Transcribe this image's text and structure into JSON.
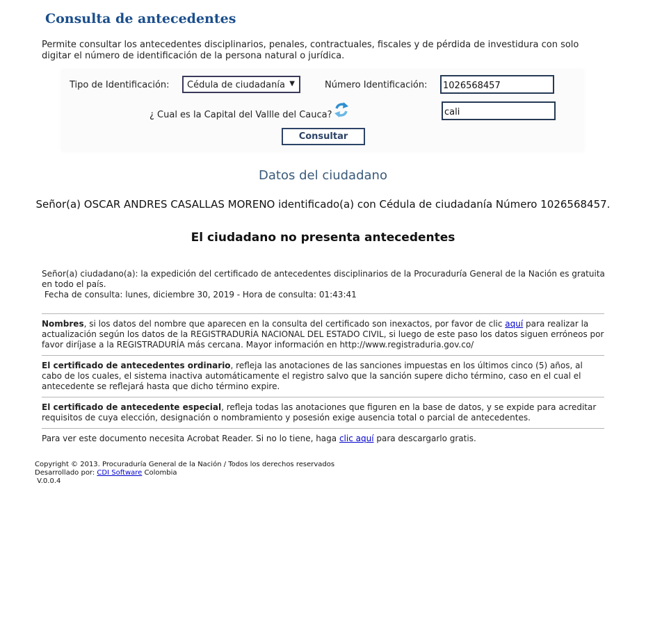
{
  "header": {
    "title": "Consulta de antecedentes"
  },
  "intro": "Permite consultar los antecedentes disciplinarios, penales, contractuales, fiscales y de pérdida de investidura con solo digitar el número de identificación de la persona natural o jurídica.",
  "form": {
    "id_type_label": "Tipo de Identificación:",
    "id_type_value": "Cédula de ciudadanía",
    "id_number_label": "Número Identificación:",
    "id_number_value": "1026568457",
    "question_label": "¿ Cual es la Capital del Vallle del Cauca?",
    "answer_value": "cali",
    "submit_label": "Consultar"
  },
  "result": {
    "section_title": "Datos del ciudadano",
    "citizen_line": "Señor(a)  OSCAR ANDRES CASALLAS MORENO identificado(a) con Cédula de ciudadanía Número 1026568457.",
    "status": "El ciudadano no presenta antecedentes"
  },
  "notice": {
    "free_text": "Señor(a) ciudadano(a): la expedición del certificado de antecedentes disciplinarios de la Procuraduría General de la Nación es gratuita en todo el país.",
    "date_line": " Fecha de consulta: lunes, diciembre 30, 2019 - Hora de consulta: 01:43:41"
  },
  "names_note": {
    "bold": "Nombres",
    "text1": ", si los datos del nombre que aparecen en la consulta del certificado son inexactos, por favor de clic ",
    "link": "aquí",
    "text2": " para realizar la actualización según los datos de la REGISTRADURÍA NACIONAL DEL ESTADO CIVIL, si luego de este paso los datos siguen erróneos por favor diríjase a la REGISTRADURÍA más cercana. Mayor información en http://www.registraduria.gov.co/"
  },
  "ordinary_note": {
    "bold": "El certificado de antecedentes ordinario",
    "text": ", refleja las anotaciones de las sanciones impuestas en los últimos cinco (5) años, al cabo de los cuales, el sistema inactiva automáticamente el registro salvo que la sanción supere dicho término, caso en el cual el antecedente se reflejará hasta que dicho término expire."
  },
  "special_note": {
    "bold": "El certificado de antecedente especial",
    "text": ", refleja todas las anotaciones que figuren en la base de datos, y se expide para acreditar requisitos de cuya elección, designación o nombramiento y posesión exige ausencia total o parcial de antecedentes."
  },
  "acrobat_note": {
    "text1": "Para ver este documento necesita Acrobat Reader. Si no lo tiene, haga ",
    "link": "clic aquí",
    "text2": " para descargarlo gratis."
  },
  "footer": {
    "copyright": "Copyright © 2013. Procuraduría General de la Nación / Todos los derechos reservados",
    "dev_prefix": "Desarrollado por: ",
    "dev_link": "CDI Software",
    "dev_suffix": " Colombia",
    "version": " V.0.0.4"
  },
  "icons": {
    "refresh": "refresh-icon",
    "dropdown": "chevron-down-icon"
  },
  "colors": {
    "title": "#1a4e8c",
    "subtitle": "#3a5a7a",
    "link": "#0000cc"
  }
}
